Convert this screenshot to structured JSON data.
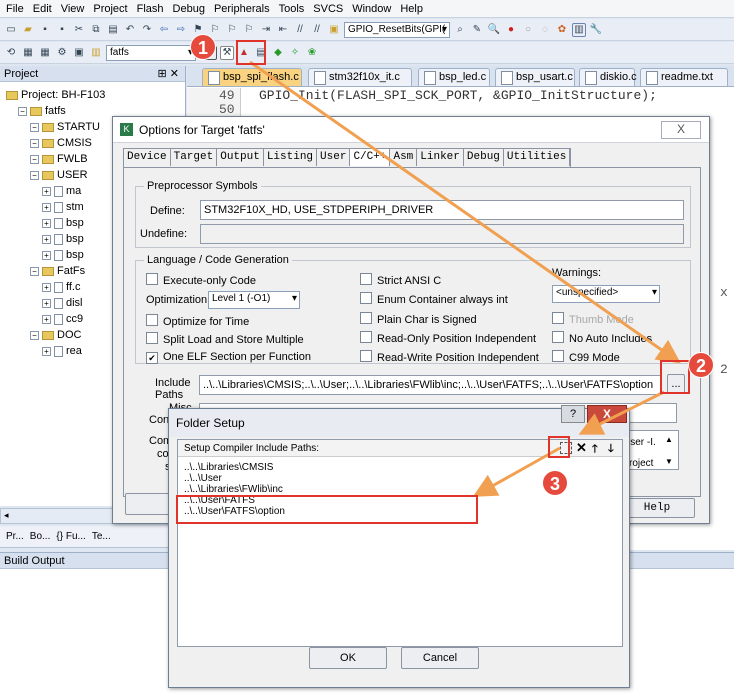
{
  "menu": [
    "File",
    "Edit",
    "View",
    "Project",
    "Flash",
    "Debug",
    "Peripherals",
    "Tools",
    "SVCS",
    "Window",
    "Help"
  ],
  "toolbar": {
    "function_combo": "GPIO_ResetBits(GPI(",
    "target_combo": "fatfs"
  },
  "project_panel": {
    "title": "Project",
    "items": [
      {
        "label": "Project: BH-F103",
        "kind": "project",
        "indent": 0
      },
      {
        "label": "fatfs",
        "kind": "folder",
        "indent": 1
      },
      {
        "label": "STARTU",
        "kind": "folder",
        "indent": 2
      },
      {
        "label": "CMSIS",
        "kind": "folder",
        "indent": 2
      },
      {
        "label": "FWLB",
        "kind": "folder",
        "indent": 2
      },
      {
        "label": "USER",
        "kind": "folder",
        "indent": 2
      },
      {
        "label": "ma",
        "kind": "file",
        "indent": 3
      },
      {
        "label": "stm",
        "kind": "file",
        "indent": 3
      },
      {
        "label": "bsp",
        "kind": "file",
        "indent": 3
      },
      {
        "label": "bsp",
        "kind": "file",
        "indent": 3
      },
      {
        "label": "bsp",
        "kind": "file",
        "indent": 3
      },
      {
        "label": "FatFs",
        "kind": "folder",
        "indent": 2
      },
      {
        "label": "ff.c",
        "kind": "file",
        "indent": 3
      },
      {
        "label": "disl",
        "kind": "file",
        "indent": 3
      },
      {
        "label": "cc9",
        "kind": "file",
        "indent": 3
      },
      {
        "label": "DOC",
        "kind": "folder",
        "indent": 2
      },
      {
        "label": "rea",
        "kind": "file",
        "indent": 3
      }
    ],
    "bottom_tabs": [
      "Pr...",
      "Bo...",
      "{} Fu...",
      "Te..."
    ]
  },
  "editor": {
    "tabs": [
      "bsp_spi_flash.c",
      "stm32f10x_it.c",
      "bsp_led.c",
      "bsp_usart.c",
      "diskio.c",
      "readme.txt"
    ],
    "lines": [
      {
        "num": "49",
        "code": "GPIO_Init(FLASH_SPI_SCK_PORT, &GPIO_InitStructure);"
      },
      {
        "num": "50",
        "code": ""
      }
    ],
    "right_fragments": [
      "x",
      "2"
    ]
  },
  "build_output": {
    "title": "Build Output"
  },
  "options_dialog": {
    "title": "Options for Target 'fatfs'",
    "close": "X",
    "tabs": [
      "Device",
      "Target",
      "Output",
      "Listing",
      "User",
      "C/C++",
      "Asm",
      "Linker",
      "Debug",
      "Utilities"
    ],
    "preprocessor": {
      "title": "Preprocessor Symbols",
      "define_label": "Define:",
      "define_value": "STM32F10X_HD, USE_STDPERIPH_DRIVER",
      "undefine_label": "Undefine:",
      "undefine_value": ""
    },
    "codegen": {
      "title": "Language / Code Generation",
      "execute_only": "Execute-only Code",
      "optimization_label": "Optimization:",
      "optimization_value": "Level 1 (-O1)",
      "optimize_time": "Optimize for Time",
      "split_load": "Split Load and Store Multiple",
      "one_elf": "One ELF Section per Function",
      "strict_ansi": "Strict ANSI C",
      "enum_container": "Enum Container always int",
      "plain_char": "Plain Char is Signed",
      "ro_pi": "Read-Only Position Independent",
      "rw_pi": "Read-Write Position Independent",
      "warnings_label": "Warnings:",
      "warnings_value": "<unspecified>",
      "thumb_mode": "Thumb Mode",
      "no_auto_includes": "No Auto Includes",
      "c99_mode": "C99 Mode"
    },
    "include_label": "Include\nPaths",
    "include_value": "..\\..\\Libraries\\CMSIS;..\\..\\User;..\\..\\Libraries\\FWlib\\inc;..\\..\\User\\FATFS;..\\..\\User\\FATFS\\option",
    "browse_button": "...",
    "misc_label": "Misc",
    "controls_label": "Con",
    "compiler_label": "Comp",
    "compiler_side": [
      "co",
      "st"
    ],
    "compiler_right": [
      "User -I.",
      "roject"
    ],
    "help_button": "Help"
  },
  "folder_dialog": {
    "title": "Folder Setup",
    "help_icon": "?",
    "close": "X",
    "header": "Setup Compiler Include Paths:",
    "paths": [
      "..\\..\\Libraries\\CMSIS",
      "..\\..\\User",
      "..\\..\\Libraries\\FWlib\\inc",
      "..\\..\\User\\FATFS",
      "..\\..\\User\\FATFS\\option"
    ],
    "ok": "OK",
    "cancel": "Cancel"
  },
  "annotations": {
    "step1": "1",
    "step2": "2",
    "step3": "3"
  },
  "colors": {
    "annotation": "#e0332a",
    "arrow": "#f0a050",
    "active_tab": "#f9d37f"
  }
}
